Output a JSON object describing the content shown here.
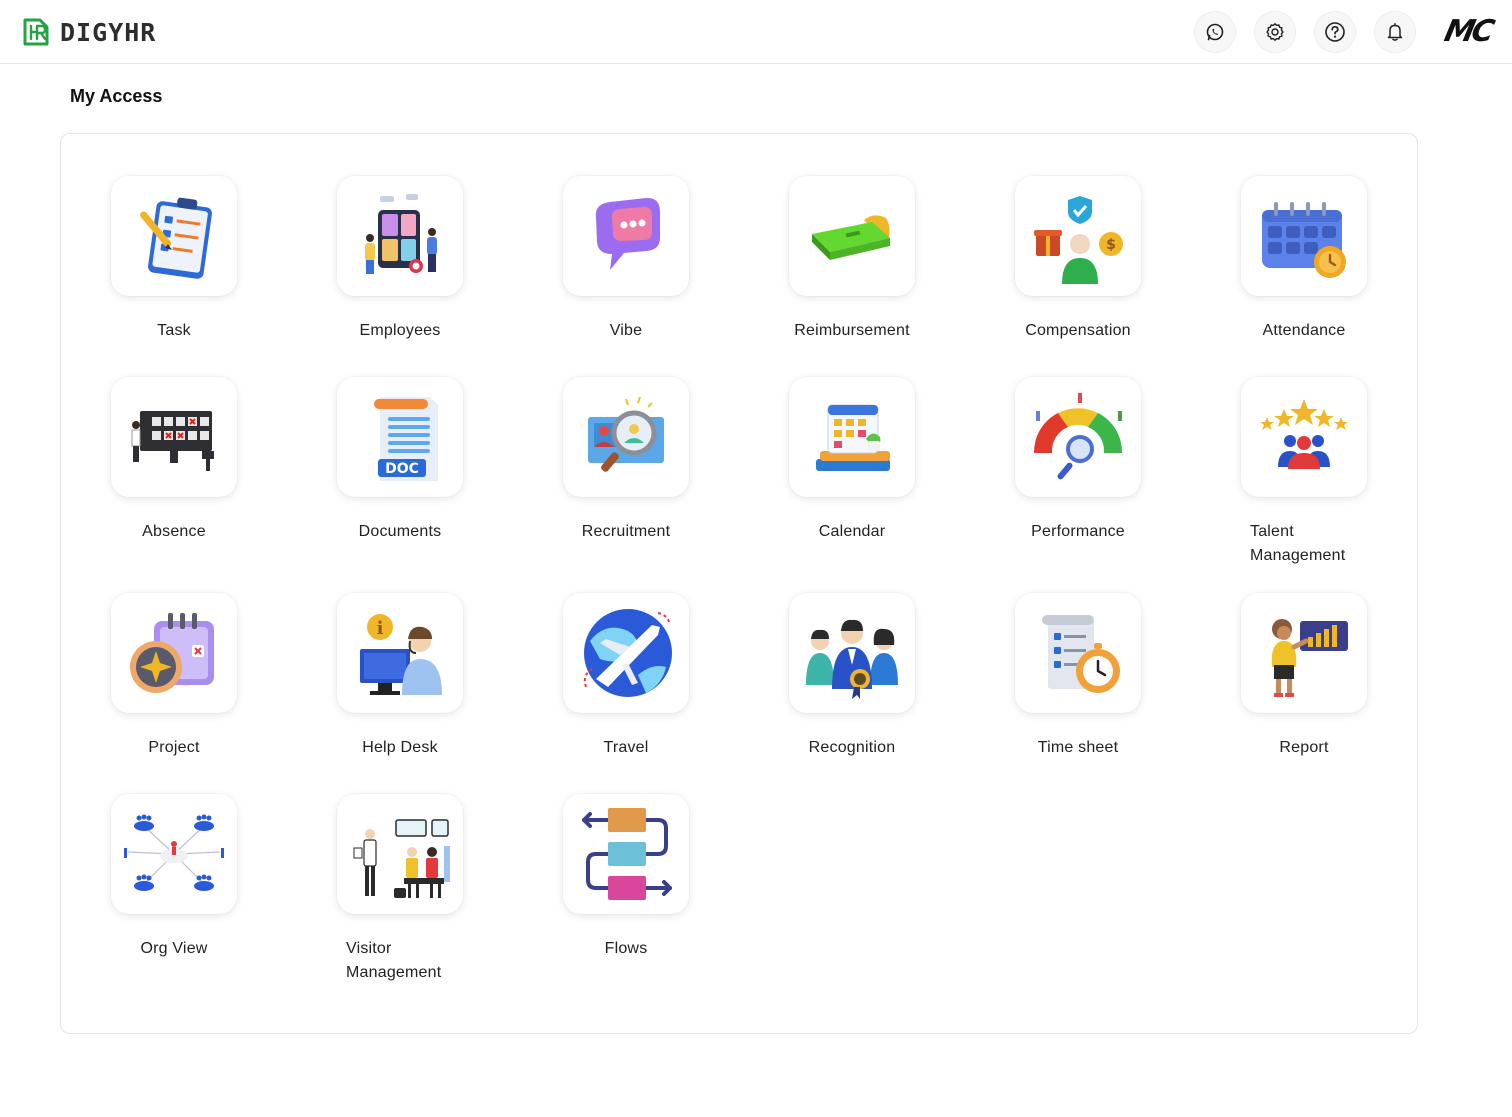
{
  "header": {
    "app_name": "DIGYHR",
    "logo_icon": "hr-logo-icon",
    "actions": [
      {
        "name": "whatsapp-icon"
      },
      {
        "name": "gear-icon"
      },
      {
        "name": "help-icon"
      },
      {
        "name": "bell-icon"
      }
    ],
    "brand_partial": "MC"
  },
  "page": {
    "title": "My Access"
  },
  "apps": [
    {
      "label": "Task",
      "icon": "task-clipboard-icon"
    },
    {
      "label": "Employees",
      "icon": "employees-icon"
    },
    {
      "label": "Vibe",
      "icon": "chat-bubble-icon"
    },
    {
      "label": "Reimbursement",
      "icon": "cash-icon"
    },
    {
      "label": "Compensation",
      "icon": "compensation-icon"
    },
    {
      "label": "Attendance",
      "icon": "calendar-clock-icon"
    },
    {
      "label": "Absence",
      "icon": "absence-board-icon"
    },
    {
      "label": "Documents",
      "icon": "document-icon"
    },
    {
      "label": "Recruitment",
      "icon": "magnifier-person-icon"
    },
    {
      "label": "Calendar",
      "icon": "calendar-icon"
    },
    {
      "label": "Performance",
      "icon": "gauge-icon"
    },
    {
      "label": "Talent Management",
      "icon": "stars-people-icon"
    },
    {
      "label": "Project",
      "icon": "project-notebook-icon"
    },
    {
      "label": "Help Desk",
      "icon": "help-desk-icon"
    },
    {
      "label": "Travel",
      "icon": "airplane-globe-icon"
    },
    {
      "label": "Recognition",
      "icon": "award-team-icon"
    },
    {
      "label": "Time sheet",
      "icon": "timesheet-stopwatch-icon"
    },
    {
      "label": "Report",
      "icon": "report-chart-icon"
    },
    {
      "label": "Org View",
      "icon": "org-network-icon"
    },
    {
      "label": "Visitor Management",
      "icon": "visitor-icon"
    },
    {
      "label": "Flows",
      "icon": "flow-blocks-icon"
    }
  ]
}
